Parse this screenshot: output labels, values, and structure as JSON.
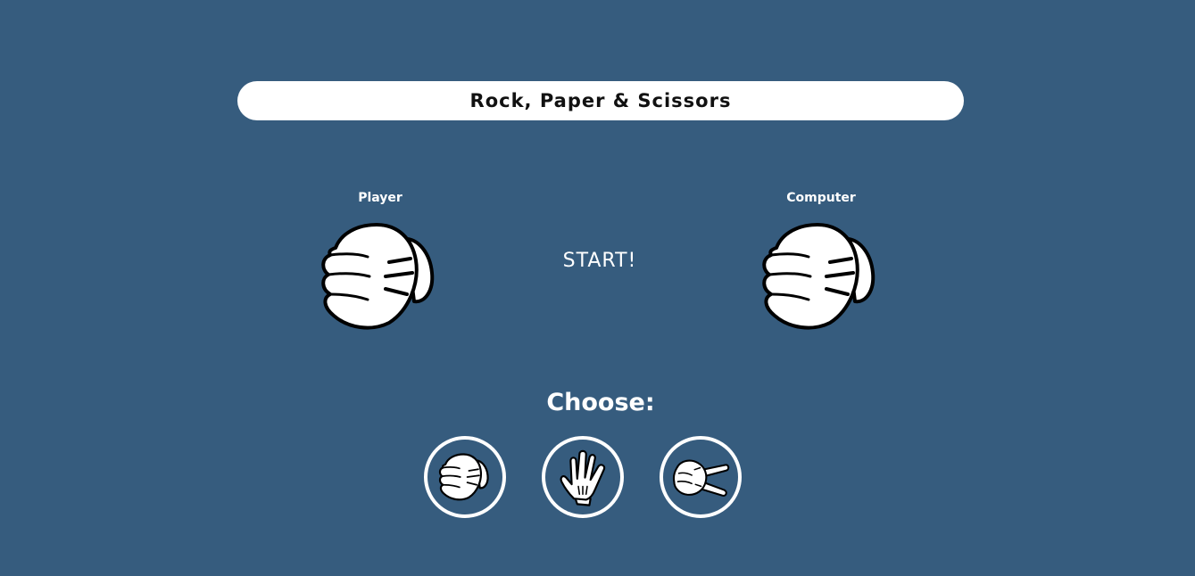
{
  "header": {
    "title": "Rock, Paper & Scissors"
  },
  "arena": {
    "player_label": "Player",
    "computer_label": "Computer",
    "status": "START!",
    "player_choice": "rock",
    "computer_choice": "rock"
  },
  "choices": {
    "label": "Choose:",
    "options": [
      {
        "name": "rock",
        "icon": "rock-hand-icon"
      },
      {
        "name": "paper",
        "icon": "paper-hand-icon"
      },
      {
        "name": "scissors",
        "icon": "scissors-hand-icon"
      }
    ]
  },
  "colors": {
    "background": "#365c7e",
    "foreground": "#ffffff",
    "title_text": "#111111"
  }
}
